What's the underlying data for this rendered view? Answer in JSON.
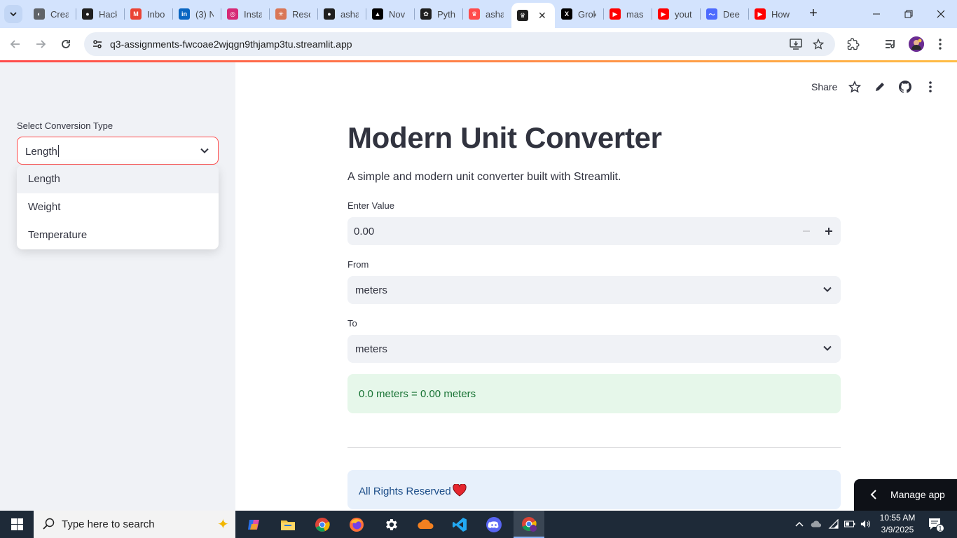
{
  "browser": {
    "tabs": [
      {
        "label": "Crea",
        "icon": "globe-icon",
        "color": "#5f6368"
      },
      {
        "label": "Hack",
        "icon": "github-icon",
        "color": "#1f1f1f"
      },
      {
        "label": "Inbo",
        "icon": "gmail-icon",
        "color": "#ea4335"
      },
      {
        "label": "(3) N",
        "icon": "linkedin-icon",
        "color": "#0a66c2"
      },
      {
        "label": "Insta",
        "icon": "instagram-icon",
        "color": "#d62976"
      },
      {
        "label": "Reso",
        "icon": "claude-icon",
        "color": "#d97757"
      },
      {
        "label": "asha",
        "icon": "github-icon",
        "color": "#1f1f1f"
      },
      {
        "label": "Nov",
        "icon": "notion-icon",
        "color": "#000000"
      },
      {
        "label": "Pyth",
        "icon": "chatgpt-icon",
        "color": "#1f1f1f"
      },
      {
        "label": "asha",
        "icon": "streamlit-icon",
        "color": "#ff4b4b"
      },
      {
        "label": "",
        "icon": "streamlit-icon",
        "color": "#1f1f1f",
        "active": true
      },
      {
        "label": "Grok",
        "icon": "x-icon",
        "color": "#000000"
      },
      {
        "label": "mas",
        "icon": "youtube-icon",
        "color": "#ff0000"
      },
      {
        "label": "yout",
        "icon": "youtube-icon",
        "color": "#ff0000"
      },
      {
        "label": "Dee",
        "icon": "deepseek-icon",
        "color": "#4d6bfe"
      },
      {
        "label": "How",
        "icon": "youtube-icon",
        "color": "#ff0000"
      }
    ],
    "url": "q3-assignments-fwcoae2wjqgn9thjamp3tu.streamlit.app"
  },
  "sidebar": {
    "select_label": "Select Conversion Type",
    "select_value": "Length",
    "options": [
      "Length",
      "Weight",
      "Temperature"
    ]
  },
  "header": {
    "share_label": "Share"
  },
  "main": {
    "title": "Modern Unit Converter",
    "subtitle": "A simple and modern unit converter built with Streamlit.",
    "value_label": "Enter Value",
    "value": "0.00",
    "from_label": "From",
    "from_value": "meters",
    "to_label": "To",
    "to_value": "meters",
    "result": "0.0 meters = 0.00 meters",
    "footer": "All Rights Reserved"
  },
  "manage_app": "Manage app",
  "taskbar": {
    "search_placeholder": "Type here to search",
    "time": "10:55 AM",
    "date": "3/9/2025",
    "notification_count": "1"
  },
  "colors": {
    "accent": "#ff4b4b",
    "success_bg": "#e6f7ea",
    "success_text": "#177233",
    "info_bg": "#e7f0fb",
    "info_text": "#1d4e89"
  }
}
